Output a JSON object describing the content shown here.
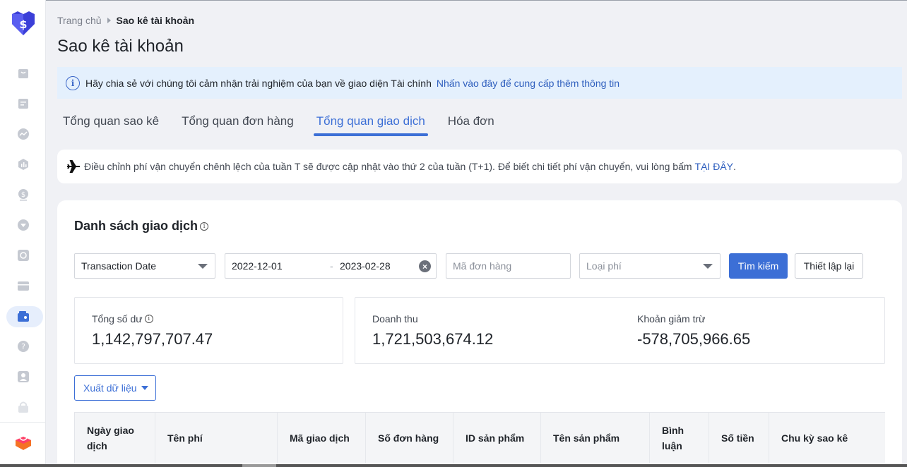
{
  "breadcrumb": {
    "home": "Trang chủ",
    "current": "Sao kê tài khoản"
  },
  "page_title": "Sao kê tài khoản",
  "info_banner": {
    "message": "Hãy chia sẻ với chúng tôi cảm nhận trải nghiệm của bạn về giao diện Tài chính",
    "link": "Nhấn vào đây để cung cấp thêm thông tin"
  },
  "tabs": [
    {
      "label": "Tổng quan sao kê",
      "active": false
    },
    {
      "label": "Tổng quan đơn hàng",
      "active": false
    },
    {
      "label": "Tổng quan giao dịch",
      "active": true
    },
    {
      "label": "Hóa đơn",
      "active": false
    }
  ],
  "notice": {
    "message": "Điều chỉnh phí vận chuyển chênh lệch của tuần T sẽ được cập nhật vào thứ 2 của tuần (T+1). Để biết chi tiết phí vận chuyển, vui lòng bấm",
    "link": "TẠI ĐÂY",
    "suffix": "."
  },
  "transactions": {
    "title": "Danh sách giao dịch",
    "filters": {
      "date_type": "Transaction Date",
      "date_start": "2022-12-01",
      "date_separator": "-",
      "date_end": "2023-02-28",
      "order_placeholder": "Mã đơn hàng",
      "fee_type_placeholder": "Loại phí",
      "search_label": "Tìm kiếm",
      "reset_label": "Thiết lập lại"
    },
    "stats": {
      "balance_label": "Tổng số dư",
      "balance_value": "1,142,797,707.47",
      "revenue_label": "Doanh thu",
      "revenue_value": "1,721,503,674.12",
      "deduction_label": "Khoản giảm trừ",
      "deduction_value": "-578,705,966.65"
    },
    "export_label": "Xuất dữ liệu",
    "columns": [
      "Ngày giao dịch",
      "Tên phí",
      "Mã giao dịch",
      "Số đơn hàng",
      "ID sản phẩm",
      "Tên sản phẩm",
      "Bình luận",
      "Số tiền",
      "Chu kỳ sao kê"
    ]
  },
  "sidebar": {
    "items": [
      {
        "icon": "shop-bag-icon"
      },
      {
        "icon": "orders-icon"
      },
      {
        "icon": "marketing-icon"
      },
      {
        "icon": "data-insights-icon"
      },
      {
        "icon": "finance-dollar-icon"
      },
      {
        "icon": "growth-icon"
      },
      {
        "icon": "engagement-icon"
      },
      {
        "icon": "store-icon"
      },
      {
        "icon": "wallet-icon",
        "active": true
      },
      {
        "icon": "help-icon"
      },
      {
        "icon": "account-icon"
      },
      {
        "icon": "lock-icon"
      }
    ]
  },
  "colors": {
    "accent": "#3c6fd6",
    "banner_bg": "#e4f0fd",
    "page_bg": "#f0f1f5",
    "logo": "#3b3fd8"
  }
}
